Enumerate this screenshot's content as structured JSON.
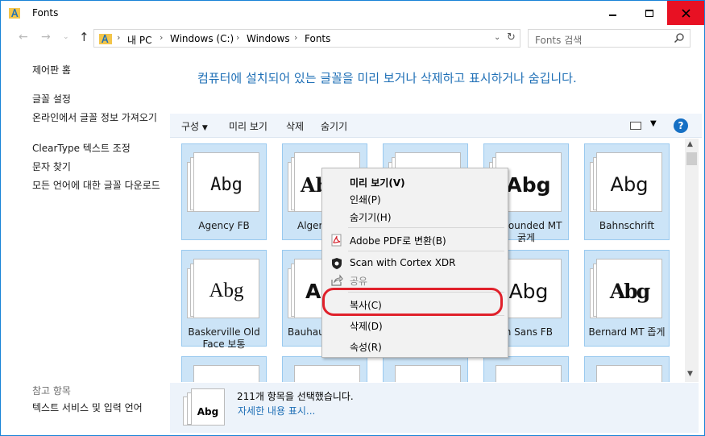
{
  "window": {
    "title": "Fonts",
    "accent": "#1883d7",
    "close_color": "#e81123"
  },
  "address": {
    "crumbs": [
      "내 PC",
      "Windows (C:)",
      "Windows",
      "Fonts"
    ],
    "search_placeholder": "Fonts 검색"
  },
  "left_pane": {
    "links": [
      "제어판 홈",
      "글꼴 설정",
      "온라인에서 글꼴 정보 가져오기",
      "ClearType 텍스트 조정",
      "문자 찾기",
      "모든 언어에 대한 글꼴 다운로드"
    ],
    "see_also_heading": "참고 항목",
    "see_also_links": [
      "텍스트 서비스 및 입력 언어"
    ]
  },
  "heading": "컴퓨터에 설치되어 있는 글꼴을 미리 보거나 삭제하고 표시하거나 숨깁니다.",
  "toolbar": {
    "organize": "구성",
    "preview": "미리 보기",
    "delete": "삭제",
    "hide": "숨기기"
  },
  "fonts": [
    {
      "name": "Agency FB",
      "sample": "Abg"
    },
    {
      "name": "Algeria",
      "sample": "Ab"
    },
    {
      "name": "",
      "sample": ""
    },
    {
      "name": "al Rounded MT 굵게",
      "sample": "Abg"
    },
    {
      "name": "Bahnschrift",
      "sample": "Abg"
    },
    {
      "name": "Baskerville Old Face 보통",
      "sample": "Abg"
    },
    {
      "name": "Bauhaus",
      "sample": "Ab"
    },
    {
      "name": "",
      "sample": ""
    },
    {
      "name": "lin Sans FB",
      "sample": "Abg"
    },
    {
      "name": "Bernard MT 좁게",
      "sample": "Abg"
    }
  ],
  "details": {
    "count_text": "211개 항목을 선택했습니다.",
    "more_link": "자세한 내용 표시...",
    "sample": "Abg"
  },
  "context_menu": {
    "preview": "미리 보기(V)",
    "print": "인쇄(P)",
    "hide": "숨기기(H)",
    "adobe_pdf": "Adobe PDF로 변환(B)",
    "cortex": "Scan with Cortex XDR",
    "share": "공유",
    "copy": "복사(C)",
    "delete": "삭제(D)",
    "properties": "속성(R)"
  },
  "annotation_color": "#e0212b"
}
